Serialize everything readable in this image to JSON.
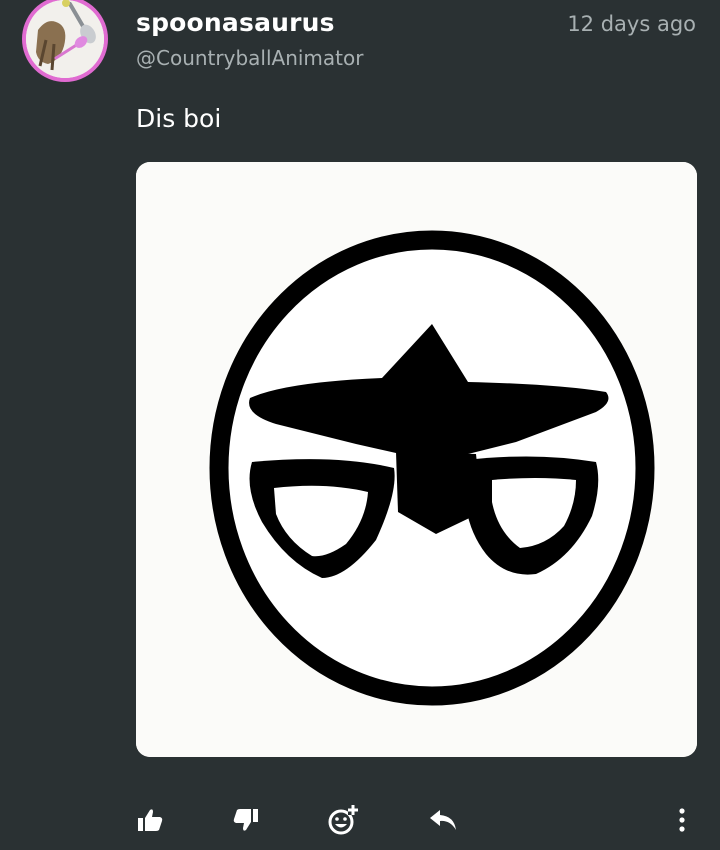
{
  "post": {
    "username": "spoonasaurus",
    "handle": "@CountryballAnimator",
    "timestamp": "12 days ago",
    "text": "Dis boi"
  },
  "avatar": {
    "icon": "spoon-dinosaur-avatar",
    "ring_color": "#e06bd1"
  },
  "image": {
    "icon": "countryball-drawing"
  },
  "actions": [
    {
      "icon": "thumbs-up-icon"
    },
    {
      "icon": "thumbs-down-icon"
    },
    {
      "icon": "add-reaction-icon"
    },
    {
      "icon": "reply-icon"
    },
    {
      "icon": "more-vertical-icon"
    }
  ],
  "colors": {
    "background": "#2a3133",
    "text_primary": "#ffffff",
    "text_secondary": "#a8b0b2",
    "avatar_ring": "#e06bd1"
  }
}
